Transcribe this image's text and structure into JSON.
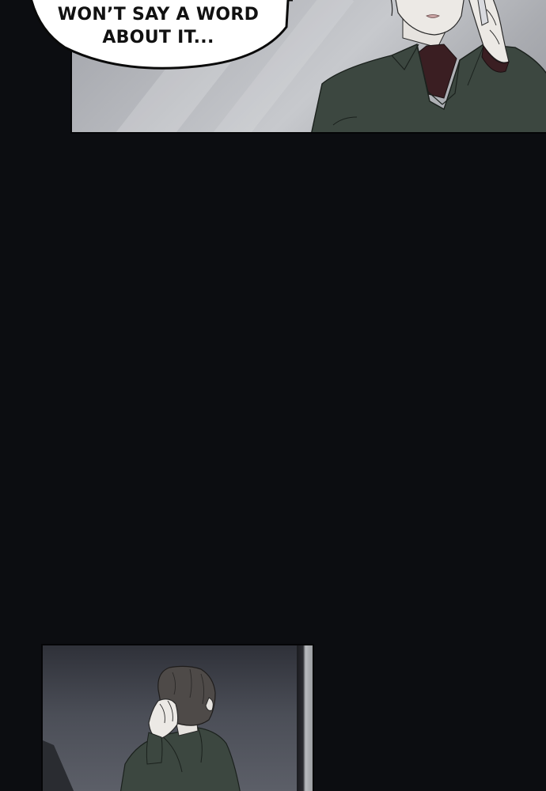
{
  "comic": {
    "speech_bubble": {
      "line1": "WON’T SAY A WORD",
      "line2": "ABOUT IT..."
    }
  },
  "colors": {
    "gutter": "#0c0d11",
    "bubble_fill": "#ffffff",
    "bubble_outline": "#0a0a0a",
    "coat_green": "#3c4740",
    "shirt_maroon": "#3a1e22"
  }
}
